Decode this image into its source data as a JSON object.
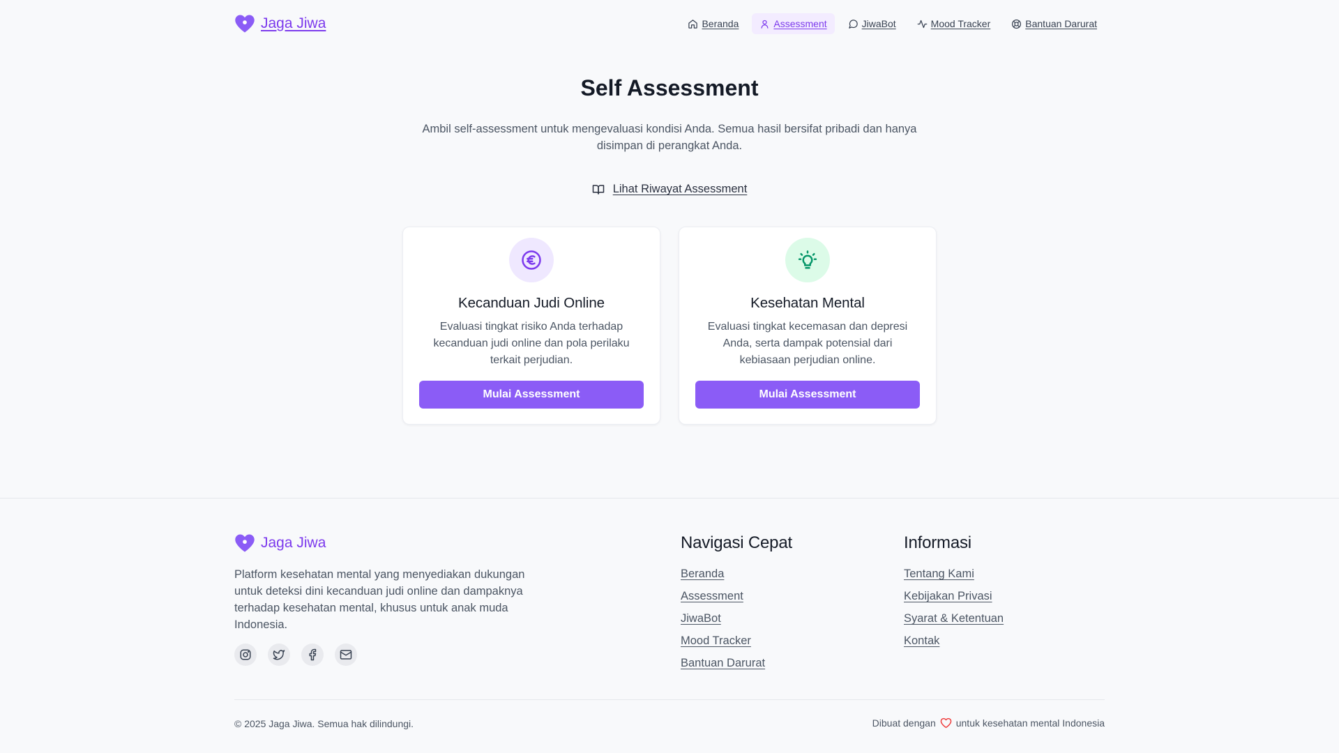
{
  "header": {
    "brand": "Jaga Jiwa",
    "nav": [
      {
        "label": "Beranda",
        "icon": "home-icon"
      },
      {
        "label": "Assessment",
        "icon": "user-icon",
        "active": true
      },
      {
        "label": "JiwaBot",
        "icon": "chat-bubble-icon"
      },
      {
        "label": "Mood Tracker",
        "icon": "activity-icon"
      },
      {
        "label": "Bantuan Darurat",
        "icon": "life-buoy-icon"
      }
    ]
  },
  "hero": {
    "title": "Self Assessment",
    "subtitle": "Ambil self-assessment untuk mengevaluasi kondisi Anda. Semua hasil bersifat pribadi dan hanya disimpan di perangkat Anda.",
    "history_link": "Lihat Riwayat Assessment",
    "history_icon": "book-open-icon"
  },
  "cards": [
    {
      "icon": "euro-coin-icon",
      "title": "Kecanduan Judi Online",
      "description": "Evaluasi tingkat risiko Anda terhadap kecanduan judi online dan pola perilaku terkait perjudian.",
      "button": "Mulai Assessment"
    },
    {
      "icon": "lightbulb-icon",
      "title": "Kesehatan Mental",
      "description": "Evaluasi tingkat kecemasan dan depresi Anda, serta dampak potensial dari kebiasaan perjudian online.",
      "button": "Mulai Assessment"
    }
  ],
  "footer": {
    "brand": "Jaga Jiwa",
    "description": "Platform kesehatan mental yang menyediakan dukungan untuk deteksi dini kecanduan judi online dan dampaknya terhadap kesehatan mental, khusus untuk anak muda Indonesia.",
    "socials": [
      "instagram-icon",
      "twitter-icon",
      "facebook-icon",
      "mail-icon"
    ],
    "nav_title": "Navigasi Cepat",
    "nav_links": [
      "Beranda",
      "Assessment",
      "JiwaBot",
      "Mood Tracker",
      "Bantuan Darurat"
    ],
    "info_title": "Informasi",
    "info_links": [
      "Tentang Kami",
      "Kebijakan Privasi",
      "Syarat & Ketentuan",
      "Kontak"
    ],
    "copyright": "© 2025 Jaga Jiwa. Semua hak dilindungi.",
    "made_with_prefix": "Dibuat dengan",
    "made_with_suffix": "untuk kesehatan mental Indonesia"
  },
  "colors": {
    "brand": "#7c3aed",
    "button": "#8b5cf6",
    "purple_tint": "#efe8ff",
    "green_tint": "#dcfbe8",
    "heart_red": "#ef4444"
  }
}
